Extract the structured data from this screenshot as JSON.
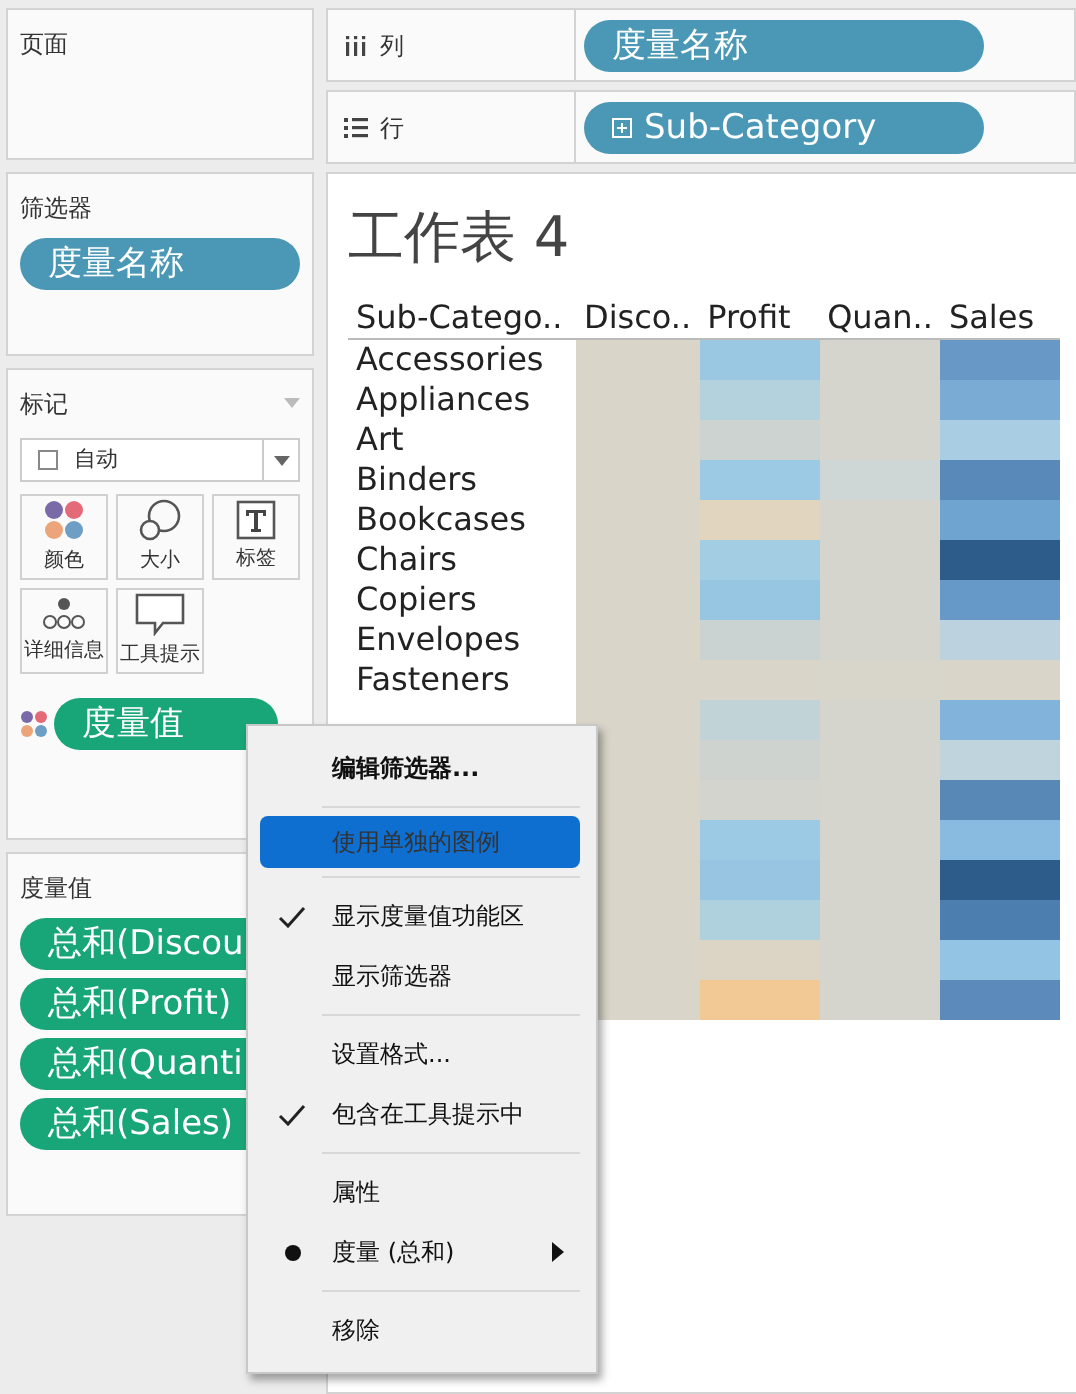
{
  "pages_panel": {
    "title": "页面"
  },
  "columns_shelf": {
    "label": "列",
    "pills": [
      {
        "label": "度量名称",
        "expandable": false
      }
    ]
  },
  "rows_shelf": {
    "label": "行",
    "pills": [
      {
        "label": "Sub-Category",
        "expandable": true
      }
    ]
  },
  "filters_panel": {
    "title": "筛选器",
    "pills": [
      {
        "label": "度量名称"
      }
    ]
  },
  "marks_panel": {
    "title": "标记",
    "mark_type": "自动",
    "buttons": [
      {
        "label": "颜色",
        "kind": "color"
      },
      {
        "label": "大小",
        "kind": "size"
      },
      {
        "label": "标签",
        "kind": "label"
      },
      {
        "label": "详细信息",
        "kind": "detail"
      },
      {
        "label": "工具提示",
        "kind": "tooltip"
      }
    ],
    "fields": [
      {
        "label": "度量值",
        "kind": "color"
      }
    ]
  },
  "measure_values_panel": {
    "title": "度量值",
    "pills": [
      {
        "label": "总和(Discou"
      },
      {
        "label": "总和(Profit)"
      },
      {
        "label": "总和(Quanti"
      },
      {
        "label": "总和(Sales)"
      }
    ]
  },
  "worksheet": {
    "title": "工作表 4",
    "columns": [
      "Sub-Catego..",
      "Disco..",
      "Profit",
      "Quan..",
      "Sales"
    ],
    "rows": [
      {
        "label": "Accessories",
        "cells": [
          {
            "color": "#d9d5c9"
          },
          {
            "color": "#9ac8e3"
          },
          {
            "color": "#d6d5cd"
          },
          {
            "color": "#6798c6"
          }
        ]
      },
      {
        "label": "Appliances",
        "cells": [
          {
            "color": "#d9d5c9"
          },
          {
            "color": "#b4d2dd"
          },
          {
            "color": "#d6d5cd"
          },
          {
            "color": "#7aabd4"
          }
        ]
      },
      {
        "label": "Art",
        "cells": [
          {
            "color": "#d9d5c9"
          },
          {
            "color": "#cdd3d1"
          },
          {
            "color": "#d6d5cd"
          },
          {
            "color": "#a9cee4"
          }
        ]
      },
      {
        "label": "Binders",
        "cells": [
          {
            "color": "#d9d5c9"
          },
          {
            "color": "#9ccae4"
          },
          {
            "color": "#cfd6d6"
          },
          {
            "color": "#5889b8"
          }
        ]
      },
      {
        "label": "Bookcases",
        "cells": [
          {
            "color": "#d9d5c9"
          },
          {
            "color": "#e2d5c0"
          },
          {
            "color": "#d6d5cd"
          },
          {
            "color": "#6fa4d0"
          }
        ]
      },
      {
        "label": "Chairs",
        "cells": [
          {
            "color": "#d9d5c9"
          },
          {
            "color": "#a3cde2"
          },
          {
            "color": "#d6d5cd"
          },
          {
            "color": "#2e5c8a"
          }
        ]
      },
      {
        "label": "Copiers",
        "cells": [
          {
            "color": "#d9d5c9"
          },
          {
            "color": "#97c6e2"
          },
          {
            "color": "#d6d5cd"
          },
          {
            "color": "#6698c8"
          }
        ]
      },
      {
        "label": "Envelopes",
        "cells": [
          {
            "color": "#d9d5c9"
          },
          {
            "color": "#cbd3d2"
          },
          {
            "color": "#d6d5cd"
          },
          {
            "color": "#bcd3df"
          }
        ]
      },
      {
        "label": "Fasteners",
        "cells": [
          {
            "color": "#d9d5c9"
          },
          {
            "color": "#d9d5c9"
          },
          {
            "color": "#d8d5cb"
          },
          {
            "color": "#d9d5c9"
          }
        ]
      },
      {
        "cells": [
          {
            "color": "#d9d5c9"
          },
          {
            "color": "#c2d3d8"
          },
          {
            "color": "#d6d5cd"
          },
          {
            "color": "#82b3da"
          }
        ]
      },
      {
        "cells": [
          {
            "color": "#d9d5c9"
          },
          {
            "color": "#cfd3cf"
          },
          {
            "color": "#d6d5cd"
          },
          {
            "color": "#c0d4dd"
          }
        ]
      },
      {
        "cells": [
          {
            "color": "#d9d5c9"
          },
          {
            "color": "#d3d4cd"
          },
          {
            "color": "#d6d5cd"
          },
          {
            "color": "#5888b6"
          }
        ]
      },
      {
        "cells": [
          {
            "color": "#d9d5c9"
          },
          {
            "color": "#9cc9e4"
          },
          {
            "color": "#d6d5cd"
          },
          {
            "color": "#89badf"
          }
        ]
      },
      {
        "cells": [
          {
            "color": "#d9d5c9"
          },
          {
            "color": "#98c6e2"
          },
          {
            "color": "#d6d5cd"
          },
          {
            "color": "#2e5c8a"
          }
        ]
      },
      {
        "cells": [
          {
            "color": "#d9d5c9"
          },
          {
            "color": "#afd0dd"
          },
          {
            "color": "#d6d5cd"
          },
          {
            "color": "#4d7eb0"
          }
        ]
      },
      {
        "cells": [
          {
            "color": "#d9d5c9"
          },
          {
            "color": "#dcd5c6"
          },
          {
            "color": "#d6d5cd"
          },
          {
            "color": "#94c4e3"
          }
        ]
      },
      {
        "cells": [
          {
            "color": "#d9d5c9"
          },
          {
            "color": "#f2c994"
          },
          {
            "color": "#d6d5cd"
          },
          {
            "color": "#5b8abb"
          }
        ]
      }
    ]
  },
  "context_menu": {
    "items": [
      {
        "kind": "item",
        "label": "编辑筛选器...",
        "default": true,
        "selected": false,
        "checked": false,
        "bullet": false,
        "submenu": false
      },
      {
        "kind": "separator"
      },
      {
        "kind": "item",
        "label": "使用单独的图例",
        "default": false,
        "selected": true,
        "checked": false,
        "bullet": false,
        "submenu": false
      },
      {
        "kind": "separator"
      },
      {
        "kind": "item",
        "label": "显示度量值功能区",
        "default": false,
        "selected": false,
        "checked": true,
        "bullet": false,
        "submenu": false
      },
      {
        "kind": "item",
        "label": "显示筛选器",
        "default": false,
        "selected": false,
        "checked": false,
        "bullet": false,
        "submenu": false
      },
      {
        "kind": "separator"
      },
      {
        "kind": "item",
        "label": "设置格式...",
        "default": false,
        "selected": false,
        "checked": false,
        "bullet": false,
        "submenu": false
      },
      {
        "kind": "item",
        "label": "包含在工具提示中",
        "default": false,
        "selected": false,
        "checked": true,
        "bullet": false,
        "submenu": false
      },
      {
        "kind": "separator"
      },
      {
        "kind": "item",
        "label": "属性",
        "default": false,
        "selected": false,
        "checked": false,
        "bullet": false,
        "submenu": false
      },
      {
        "kind": "item",
        "label": "度量 (总和)",
        "default": false,
        "selected": false,
        "checked": false,
        "bullet": true,
        "submenu": true
      },
      {
        "kind": "separator"
      },
      {
        "kind": "item",
        "label": "移除",
        "default": false,
        "selected": false,
        "checked": false,
        "bullet": false,
        "submenu": false
      }
    ]
  }
}
